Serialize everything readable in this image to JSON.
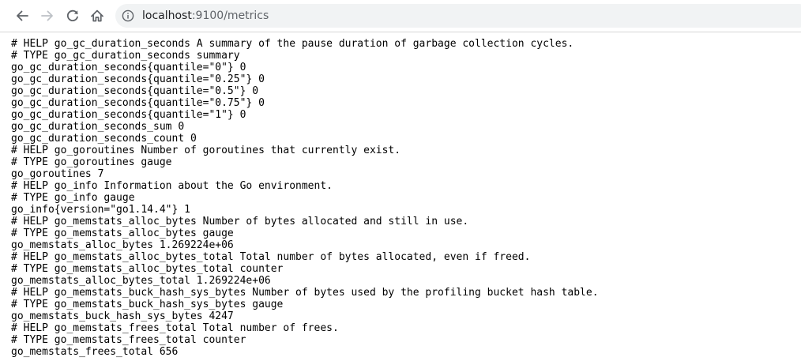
{
  "browser": {
    "icons": {
      "back": "arrow-left-icon",
      "forward": "arrow-right-icon",
      "reload": "reload-icon",
      "home": "home-icon",
      "info": "info-circle-icon"
    },
    "url_host": "localhost",
    "url_path": ":9100/metrics",
    "forward_disabled": true
  },
  "metrics": {
    "lines": [
      "# HELP go_gc_duration_seconds A summary of the pause duration of garbage collection cycles.",
      "# TYPE go_gc_duration_seconds summary",
      "go_gc_duration_seconds{quantile=\"0\"} 0",
      "go_gc_duration_seconds{quantile=\"0.25\"} 0",
      "go_gc_duration_seconds{quantile=\"0.5\"} 0",
      "go_gc_duration_seconds{quantile=\"0.75\"} 0",
      "go_gc_duration_seconds{quantile=\"1\"} 0",
      "go_gc_duration_seconds_sum 0",
      "go_gc_duration_seconds_count 0",
      "# HELP go_goroutines Number of goroutines that currently exist.",
      "# TYPE go_goroutines gauge",
      "go_goroutines 7",
      "# HELP go_info Information about the Go environment.",
      "# TYPE go_info gauge",
      "go_info{version=\"go1.14.4\"} 1",
      "# HELP go_memstats_alloc_bytes Number of bytes allocated and still in use.",
      "# TYPE go_memstats_alloc_bytes gauge",
      "go_memstats_alloc_bytes 1.269224e+06",
      "# HELP go_memstats_alloc_bytes_total Total number of bytes allocated, even if freed.",
      "# TYPE go_memstats_alloc_bytes_total counter",
      "go_memstats_alloc_bytes_total 1.269224e+06",
      "# HELP go_memstats_buck_hash_sys_bytes Number of bytes used by the profiling bucket hash table.",
      "# TYPE go_memstats_buck_hash_sys_bytes gauge",
      "go_memstats_buck_hash_sys_bytes 4247",
      "# HELP go_memstats_frees_total Total number of frees.",
      "# TYPE go_memstats_frees_total counter",
      "go_memstats_frees_total 656"
    ]
  }
}
